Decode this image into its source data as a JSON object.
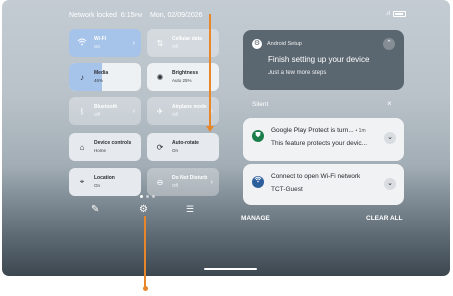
{
  "status_bar": {
    "network": "Network locked",
    "time": "6:15",
    "time_suffix": "PM",
    "date": "Mon, 02/09/2026"
  },
  "tiles": [
    {
      "label": "Wi-Fi",
      "state": "On",
      "icon": "wifi-icon",
      "has_chevron": true
    },
    {
      "label": "Cellular data",
      "state": "Off",
      "icon": "cellular-icon",
      "has_chevron": false
    },
    {
      "label": "Media",
      "state": "46%",
      "icon": "music-note-icon",
      "level": 0.46
    },
    {
      "label": "Brightness",
      "state": "Auto 25%",
      "icon": "brightness-icon"
    },
    {
      "label": "Bluetooth",
      "state": "Off",
      "icon": "bluetooth-icon",
      "has_chevron": true
    },
    {
      "label": "Airplane mode",
      "state": "Off",
      "icon": "airplane-icon",
      "has_chevron": true
    },
    {
      "label": "Device controls",
      "state": "Home",
      "icon": "home-icon"
    },
    {
      "label": "Auto-rotate",
      "state": "On",
      "icon": "rotate-icon"
    },
    {
      "label": "Location",
      "state": "On",
      "icon": "location-icon"
    },
    {
      "label": "Do Not Disturb",
      "state": "Off",
      "icon": "dnd-icon",
      "has_chevron": true
    }
  ],
  "bottom_controls": {
    "edit": "edit-icon",
    "settings": "settings-gear-icon",
    "power": "power-menu-icon"
  },
  "notifications": {
    "setup": {
      "app": "Android Setup",
      "title": "Finish setting up your device",
      "body": "Just a few more steps"
    },
    "silent_label": "Silent",
    "items": [
      {
        "title": "Google Play Protect is turn...",
        "meta": "• 1m",
        "body": "This feature protects your devic...",
        "icon": "play-protect-icon"
      },
      {
        "title": "Connect to open Wi-Fi network",
        "meta": "",
        "body": "TCT-Guest",
        "icon": "wifi-network-icon"
      }
    ],
    "manage": "MANAGE",
    "clear_all": "CLEAR ALL"
  },
  "colors": {
    "accent_tile": "#a6c3ea",
    "annotation": "#e8862a"
  }
}
